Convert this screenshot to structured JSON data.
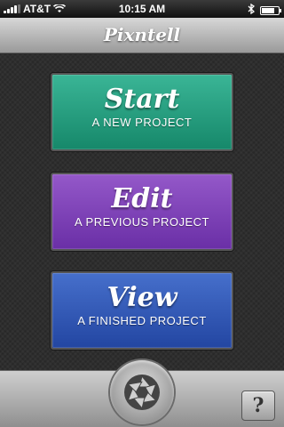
{
  "status_bar": {
    "carrier": "AT&T",
    "time": "10:15 AM",
    "battery_level": 0.75,
    "icons": [
      "signal-icon",
      "wifi-icon",
      "bluetooth-icon",
      "battery-icon"
    ]
  },
  "nav": {
    "title": "Pixntell"
  },
  "buttons": [
    {
      "id": "start",
      "title": "Start",
      "subtitle": "A NEW PROJECT",
      "color": "#27a282"
    },
    {
      "id": "edit",
      "title": "Edit",
      "subtitle": "A PREVIOUS PROJECT",
      "color": "#7f43b8"
    },
    {
      "id": "view",
      "title": "View",
      "subtitle": "A FINISHED PROJECT",
      "color": "#355ab8"
    }
  ],
  "toolbar": {
    "camera_icon": "aperture-icon",
    "help_label": "?"
  }
}
